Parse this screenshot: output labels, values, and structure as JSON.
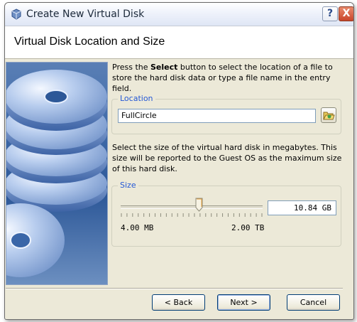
{
  "window": {
    "title": "Create New Virtual Disk",
    "help_button": "?",
    "close_button": "X"
  },
  "header": {
    "title": "Virtual Disk Location and Size"
  },
  "intro": {
    "prefix": "Press the ",
    "bold": "Select",
    "suffix": " button to select the location of a file to store the hard disk data or type a file name in the entry field."
  },
  "location": {
    "legend": "Location",
    "value": "FullCircle",
    "select_button_icon": "folder-open-icon"
  },
  "size_description": "Select the size of the virtual hard disk in megabytes. This size will be reported to the Guest OS as the maximum size of this hard disk.",
  "size": {
    "legend": "Size",
    "value": "10.84 GB",
    "min_label": "4.00 MB",
    "max_label": "2.00 TB",
    "slider_fraction": 0.55
  },
  "buttons": {
    "back": "< Back",
    "next": "Next >",
    "cancel": "Cancel"
  },
  "colors": {
    "accent": "#2458d6",
    "window_bg": "#ece9d8"
  }
}
